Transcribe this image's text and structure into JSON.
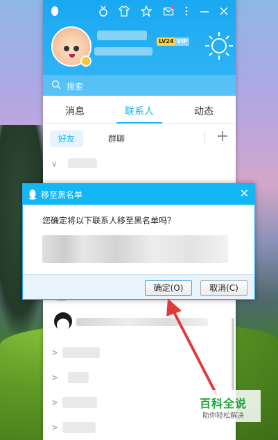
{
  "main_panel": {
    "profile": {
      "level_badge": "LV24",
      "vip_badge": "VIP"
    },
    "search": {
      "placeholder": "搜索"
    },
    "tabs": [
      {
        "label": "消息"
      },
      {
        "label": "联系人",
        "active": true
      },
      {
        "label": "动态"
      }
    ],
    "subtabs": [
      {
        "label": "好友",
        "active": true
      },
      {
        "label": "群聊"
      }
    ],
    "add_symbol": "+"
  },
  "dialog": {
    "title": "移至黑名单",
    "message": "您确定将以下联系人移至黑名单吗？",
    "ok_label": "确定(O)",
    "cancel_label": "取消(C)",
    "close_symbol": "✕"
  },
  "watermark": {
    "title": "百科全说",
    "subtitle": "助你轻松解决"
  },
  "colors": {
    "qq_blue": "#12b7f5",
    "arrow_red": "#e03b3b",
    "watermark_green": "#1aa33b"
  }
}
